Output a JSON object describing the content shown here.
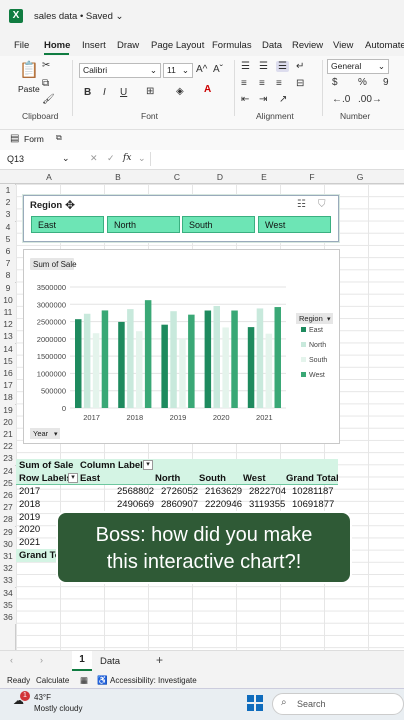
{
  "titlebar": {
    "logo": "X",
    "title": "sales data • Saved ⌄"
  },
  "menu": [
    "File",
    "Home",
    "Insert",
    "Draw",
    "Page Layout",
    "Formulas",
    "Data",
    "Review",
    "View",
    "Automate"
  ],
  "ribbon": {
    "paste_label": "Paste",
    "clipboard_label": "Clipboard",
    "font_name": "Calibri",
    "font_size": "11",
    "grow": "A^",
    "shrink": "Aˇ",
    "bold": "B",
    "italic": "I",
    "underline": "U",
    "font_label": "Font",
    "alignment_label": "Alignment",
    "number_format": "General",
    "currency": "$",
    "percent": "%",
    "comma": "9",
    "number_label": "Number"
  },
  "quickbar": {
    "form_label": "Form"
  },
  "formula": {
    "namebox": "Q13",
    "fx": "fx"
  },
  "columns": [
    "A",
    "B",
    "C",
    "D",
    "E",
    "F",
    "G"
  ],
  "rows": [
    "1",
    "2",
    "3",
    "4",
    "5",
    "6",
    "7",
    "8",
    "9",
    "10",
    "11",
    "12",
    "13",
    "14",
    "15",
    "16",
    "17",
    "18",
    "19",
    "20",
    "21",
    "22",
    "23",
    "24",
    "25",
    "26",
    "27",
    "28",
    "29",
    "30",
    "31",
    "32",
    "33",
    "34",
    "35",
    "36"
  ],
  "slicer": {
    "title": "Region",
    "items": [
      "East",
      "North",
      "South",
      "West"
    ]
  },
  "chart_data": {
    "type": "bar",
    "title": "Sum of Sale",
    "categories": [
      "2017",
      "2018",
      "2019",
      "2020",
      "2021"
    ],
    "series": [
      {
        "name": "East",
        "color": "#1e8a5e",
        "values": [
          2568802,
          2490669,
          2410000,
          2820000,
          2340000
        ]
      },
      {
        "name": "North",
        "color": "#c8e9dc",
        "values": [
          2726052,
          2860907,
          2800000,
          2950000,
          2880000
        ]
      },
      {
        "name": "South",
        "color": "#e4f4ec",
        "values": [
          2163629,
          2220946,
          2000000,
          2330000,
          2150000
        ]
      },
      {
        "name": "West",
        "color": "#3aa876",
        "values": [
          2822704,
          3119355,
          2700000,
          2820000,
          2920000
        ]
      }
    ],
    "yticks": [
      "3500000",
      "3000000",
      "2500000",
      "2000000",
      "1500000",
      "1000000",
      "500000",
      "0"
    ],
    "ylim": [
      0,
      3500000
    ],
    "legend_title": "Region",
    "axis_field": "Year"
  },
  "pivot": {
    "sum_label": "Sum of Sale",
    "col_labels": "Column Labels",
    "row_labels": "Row Labels",
    "headers": [
      "East",
      "North",
      "South",
      "West",
      "Grand Total"
    ],
    "rows": [
      {
        "label": "2017",
        "values": [
          "2568802",
          "2726052",
          "2163629",
          "2822704",
          "10281187"
        ]
      },
      {
        "label": "2018",
        "values": [
          "2490669",
          "2860907",
          "2220946",
          "3119355",
          "10691877"
        ]
      },
      {
        "label": "2019",
        "values": [
          "",
          "",
          "",
          "",
          ""
        ]
      },
      {
        "label": "2020",
        "values": [
          "",
          "",
          "",
          "",
          ""
        ]
      },
      {
        "label": "2021",
        "values": [
          "",
          "",
          "",
          "",
          ""
        ]
      }
    ],
    "grand_total": "Grand Total"
  },
  "overlay": {
    "line1": "Boss: how did you make",
    "line2": "this interactive chart?!"
  },
  "sheets": {
    "active": "1",
    "other": "Data",
    "add": "+"
  },
  "status": {
    "ready": "Ready",
    "calculate": "Calculate",
    "accessibility": "Accessibility: Investigate"
  },
  "taskbar": {
    "temp": "43°F",
    "weather": "Mostly cloudy",
    "search": "Search",
    "badge": "1"
  }
}
